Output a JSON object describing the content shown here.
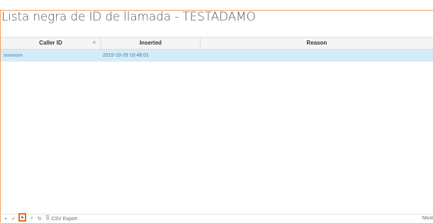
{
  "page": {
    "title": "Lista negra de ID de llamada - TESTADAMO"
  },
  "table": {
    "columns": [
      "Caller ID",
      "Inserted",
      "Reason"
    ],
    "rows": [
      {
        "caller_id": "xxxxxxxxx",
        "inserted": "2015-10-29 10:48:01",
        "reason": ""
      }
    ]
  },
  "toolbar": {
    "add_icon": "+",
    "edit_icon": "✓",
    "delete_icon": "●",
    "search_icon": "⌕",
    "refresh_icon": "↻",
    "csv_icon": "⎘",
    "csv_label": "CSV Export",
    "more_label": "Most"
  },
  "colors": {
    "accent": "#f0a060",
    "selected_row": "#d4ecf7",
    "highlight": "#ee6a1a"
  }
}
